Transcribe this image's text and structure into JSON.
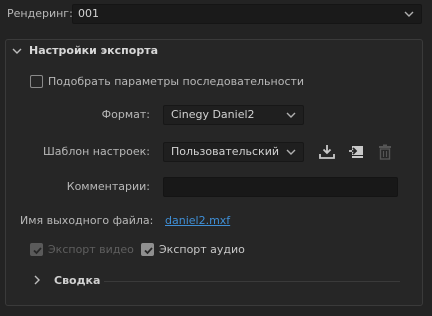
{
  "render": {
    "label": "Рендеринг:",
    "value": "001"
  },
  "export_settings": {
    "title": "Настройки экспорта",
    "match_sequence": {
      "label": "Подобрать параметры последовательности",
      "checked": false
    },
    "format": {
      "label": "Формат:",
      "value": "Cinegy Daniel2"
    },
    "preset": {
      "label": "Шаблон настроек:",
      "value": "Пользовательский",
      "icons": [
        "save-preset-icon",
        "import-preset-icon",
        "delete-preset-icon"
      ]
    },
    "comments": {
      "label": "Комментарии:",
      "value": ""
    },
    "output_name": {
      "label": "Имя выходного файла:",
      "value": "daniel2.mxf"
    },
    "export_video": {
      "label": "Экспорт видео",
      "checked": true,
      "disabled": true
    },
    "export_audio": {
      "label": "Экспорт аудио",
      "checked": true,
      "disabled": false
    },
    "summary": {
      "label": "Сводка",
      "expanded": false
    }
  },
  "colors": {
    "background": "#232323",
    "link": "#3f8fd6"
  }
}
